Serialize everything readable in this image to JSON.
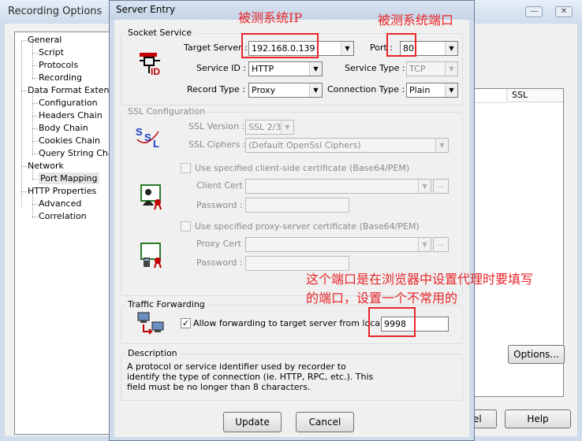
{
  "background_window": {
    "title": "Recording Options",
    "tree": [
      {
        "label": "General",
        "level": 0
      },
      {
        "label": "Script",
        "level": 1
      },
      {
        "label": "Protocols",
        "level": 1
      },
      {
        "label": "Recording",
        "level": 1
      },
      {
        "label": "Data Format Extensio",
        "level": 0
      },
      {
        "label": "Configuration",
        "level": 1
      },
      {
        "label": "Headers Chain",
        "level": 1
      },
      {
        "label": "Body Chain",
        "level": 1
      },
      {
        "label": "Cookies Chain",
        "level": 1
      },
      {
        "label": "Query String Chair",
        "level": 1
      },
      {
        "label": "Network",
        "level": 0
      },
      {
        "label": "Port Mapping",
        "level": 1,
        "selected": true
      },
      {
        "label": "HTTP Properties",
        "level": 0
      },
      {
        "label": "Advanced",
        "level": 1
      },
      {
        "label": "Correlation",
        "level": 1
      }
    ],
    "table_column": "SSL",
    "options_button": "Options...",
    "cancel_partial": "el",
    "help_button": "Help"
  },
  "dialog": {
    "title": "Server Entry",
    "socket_service": {
      "group_label": "Socket Service",
      "target_server_label": "Target Server :",
      "target_server_value": "192.168.0.139",
      "port_label": "Port :",
      "port_value": "80",
      "service_id_label": "Service ID :",
      "service_id_value": "HTTP",
      "service_type_label": "Service Type :",
      "service_type_value": "TCP",
      "record_type_label": "Record Type :",
      "record_type_value": "Proxy",
      "connection_type_label": "Connection Type :",
      "connection_type_value": "Plain"
    },
    "ssl_configuration": {
      "group_label": "SSL Configuration",
      "ssl_version_label": "SSL Version :",
      "ssl_version_value": "SSL 2/3",
      "ssl_ciphers_label": "SSL Ciphers :",
      "ssl_ciphers_value": "(Default OpenSsl Ciphers)",
      "client_cert_checkbox": "Use specified client-side certificate (Base64/PEM)",
      "client_cert_label": "Client Cert :",
      "password_label": "Password :",
      "proxy_cert_checkbox": "Use specified proxy-server certificate (Base64/PEM)",
      "proxy_cert_label": "Proxy Cert :",
      "proxy_password_label": "Password :",
      "browse_label": "..."
    },
    "traffic_forwarding": {
      "group_label": "Traffic Forwarding",
      "checkbox_label": "Allow forwarding to target server from local port:",
      "checked": true,
      "local_port_value": "9998"
    },
    "description": {
      "group_label": "Description",
      "text": "A protocol or service identifier used by recorder to identify the type of connection (ie. HTTP, RPC, etc.).  This field must be no longer than 8 characters."
    },
    "update_button": "Update",
    "cancel_button": "Cancel"
  },
  "annotations": {
    "target_ip_note": "被测系统IP",
    "port_note": "被测系统端口",
    "local_port_note_line1": "这个端口是在浏览器中设置代理时要填写",
    "local_port_note_line2": "的端口，设置一个不常用的"
  },
  "colors": {
    "annotation_red": "#e8262a",
    "window_frame": "#cfdceb",
    "dialog_face": "#f0f0f0"
  }
}
